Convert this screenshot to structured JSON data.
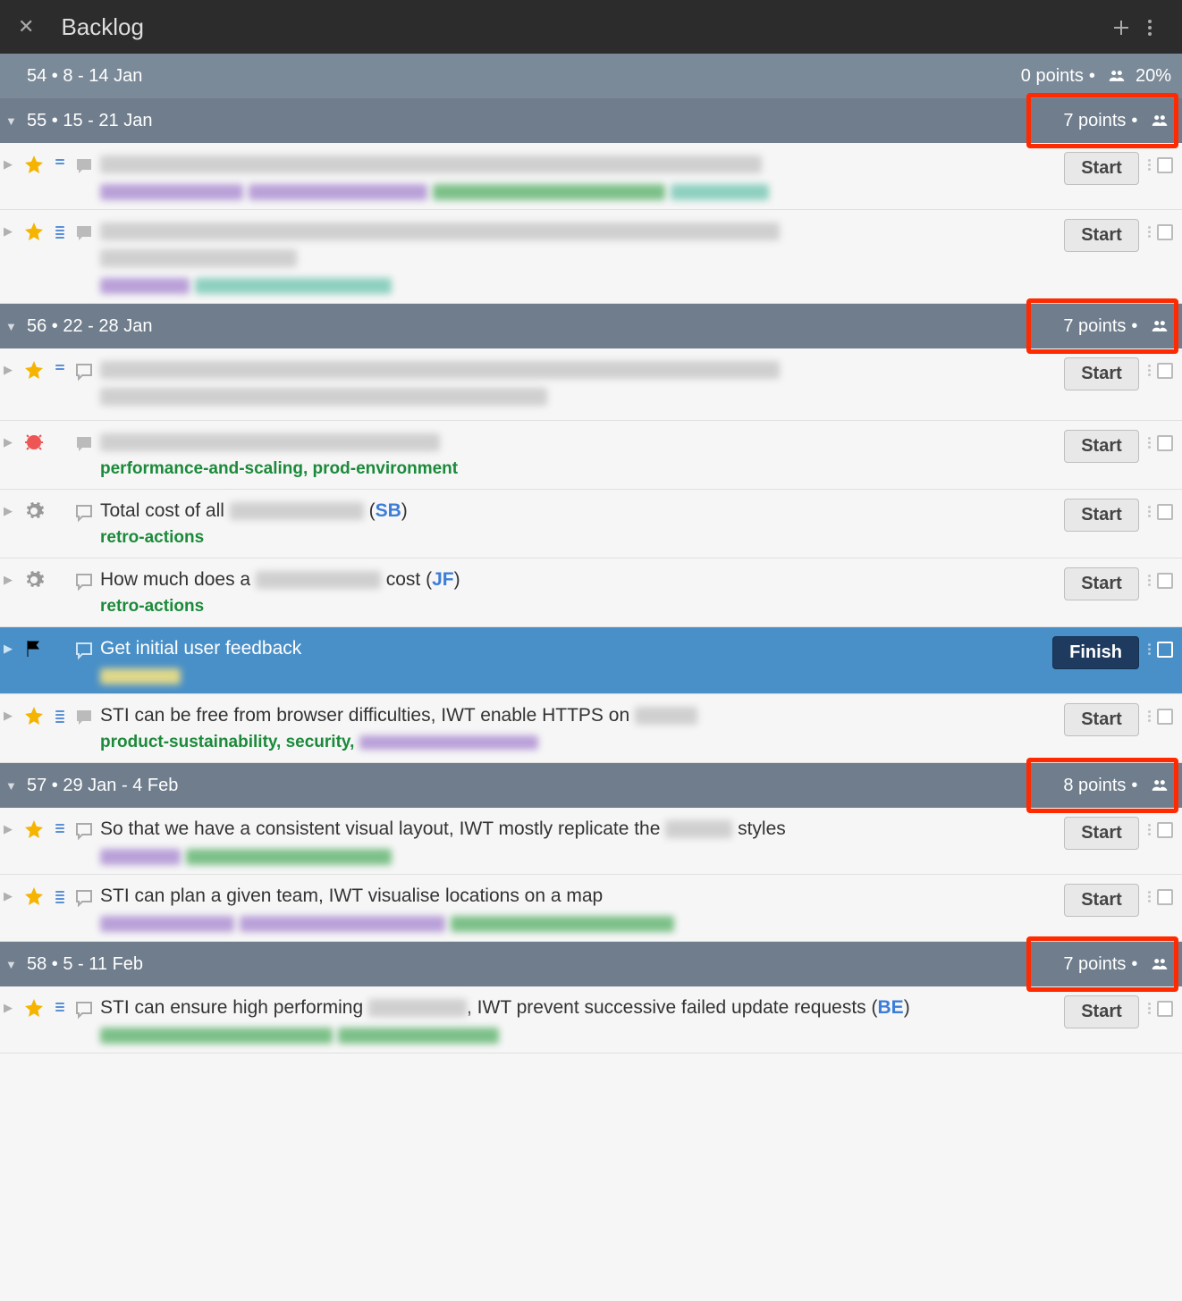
{
  "header": {
    "title": "Backlog"
  },
  "iterations": [
    {
      "id": "iter54",
      "number": "54",
      "dates": "8 - 14 Jan",
      "collapsed": true,
      "points": "0 points",
      "show_team": true,
      "percent": "20%",
      "highlight": false
    },
    {
      "id": "iter55",
      "number": "55",
      "dates": "15 - 21 Jan",
      "collapsed": false,
      "points": "7 points",
      "show_team": true,
      "percent": "",
      "highlight": true
    },
    {
      "id": "iter56",
      "number": "56",
      "dates": "22 - 28 Jan",
      "collapsed": false,
      "points": "7 points",
      "show_team": true,
      "percent": "",
      "highlight": true
    },
    {
      "id": "iter57",
      "number": "57",
      "dates": "29 Jan - 4 Feb",
      "collapsed": false,
      "points": "8 points",
      "show_team": true,
      "percent": "",
      "highlight": true
    },
    {
      "id": "iter58",
      "number": "58",
      "dates": "5 - 11 Feb",
      "collapsed": false,
      "points": "7 points",
      "show_team": true,
      "percent": "",
      "highlight": true
    }
  ],
  "stories": {
    "s1": {
      "button": "Start"
    },
    "s2": {
      "button": "Start"
    },
    "s3": {
      "button": "Start"
    },
    "s4": {
      "labels": "performance-and-scaling, prod-environment",
      "button": "Start"
    },
    "s5": {
      "title_prefix": "Total cost of all ",
      "owner": "SB",
      "labels": "retro-actions",
      "button": "Start"
    },
    "s6": {
      "title_prefix": "How much does a ",
      "title_suffix": " cost (",
      "owner": "JF",
      "labels": "retro-actions",
      "button": "Start"
    },
    "s7": {
      "title": "Get initial user feedback",
      "button": "Finish"
    },
    "s8": {
      "title_prefix": "STI can be free from browser difficulties, IWT enable HTTPS on ",
      "labels": "product-sustainability, security, ",
      "button": "Start"
    },
    "s9": {
      "title_prefix": "So that we have a consistent visual layout, IWT mostly replicate the ",
      "title_suffix": " styles",
      "button": "Start"
    },
    "s10": {
      "title": "STI can plan a given team, IWT visualise locations on a map",
      "button": "Start"
    },
    "s11": {
      "title_prefix": "STI can ensure high performing ",
      "title_suffix": ", IWT prevent successive failed update requests (",
      "owner": "BE",
      "button": "Start"
    }
  }
}
